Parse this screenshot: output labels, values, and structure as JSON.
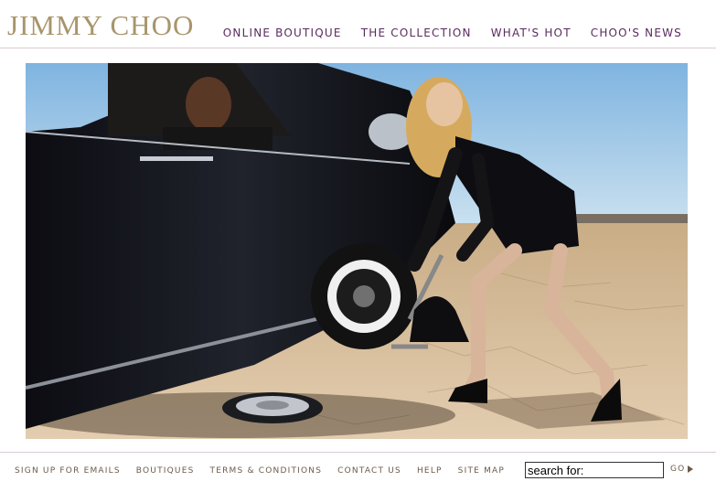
{
  "brand": {
    "logo_text": "JIMMY CHOO",
    "logo_color": "#a8956b",
    "nav_color": "#5a2b5f"
  },
  "top_nav": {
    "items": [
      {
        "label": "ONLINE BOUTIQUE"
      },
      {
        "label": "THE COLLECTION"
      },
      {
        "label": "WHAT'S HOT"
      },
      {
        "label": "CHOO'S NEWS"
      }
    ]
  },
  "hero": {
    "image": "campaign-photo",
    "sky_color": "#8fbfe6",
    "ground_color": "#cdb08c"
  },
  "footer_nav": {
    "items": [
      {
        "label": "SIGN UP FOR EMAILS"
      },
      {
        "label": "BOUTIQUES"
      },
      {
        "label": "TERMS & CONDITIONS"
      },
      {
        "label": "CONTACT US"
      },
      {
        "label": "HELP"
      },
      {
        "label": "SITE MAP"
      }
    ]
  },
  "search": {
    "value": "search for:",
    "go_label": "GO",
    "go_icon": "arrow-right-icon"
  }
}
